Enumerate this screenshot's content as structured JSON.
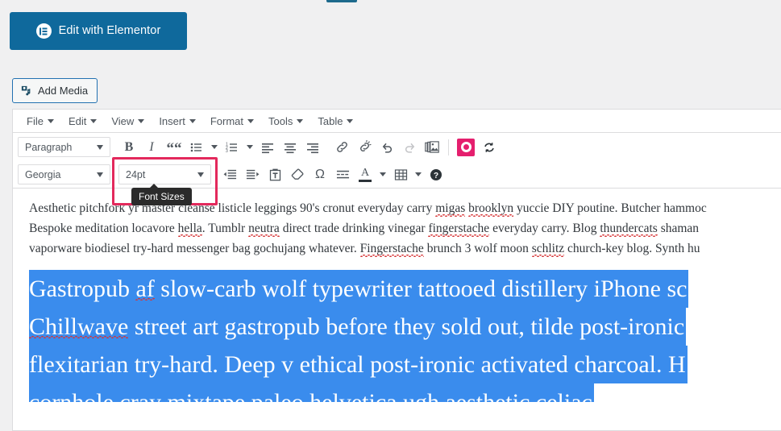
{
  "elementor_button": {
    "label": "Edit with Elementor",
    "icon": "elementor-logo-icon",
    "bg": "#0f699c"
  },
  "add_media_button": {
    "label": "Add Media",
    "icon": "media-icon"
  },
  "menubar": {
    "items": [
      {
        "label": "File"
      },
      {
        "label": "Edit"
      },
      {
        "label": "View"
      },
      {
        "label": "Insert"
      },
      {
        "label": "Format"
      },
      {
        "label": "Tools"
      },
      {
        "label": "Table"
      }
    ]
  },
  "toolbar_row1": {
    "format_select": {
      "value": "Paragraph"
    },
    "buttons": [
      {
        "name": "bold-button",
        "glyph": "B"
      },
      {
        "name": "italic-button",
        "glyph": "I"
      },
      {
        "name": "blockquote-button",
        "glyph": "“"
      },
      {
        "name": "bullet-list-button",
        "glyph": "bullist-icon"
      },
      {
        "name": "numbered-list-button",
        "glyph": "numlist-icon"
      },
      {
        "name": "align-left-button",
        "glyph": "alignleft-icon"
      },
      {
        "name": "align-center-button",
        "glyph": "aligncenter-icon"
      },
      {
        "name": "align-right-button",
        "glyph": "alignright-icon"
      },
      {
        "name": "insert-link-button",
        "glyph": "link-icon"
      },
      {
        "name": "remove-link-button",
        "glyph": "unlink-icon"
      },
      {
        "name": "undo-button",
        "glyph": "undo-icon"
      },
      {
        "name": "redo-button",
        "glyph": "redo-icon"
      },
      {
        "name": "insert-gallery-button",
        "glyph": "gallery-icon"
      },
      {
        "name": "yoast-button",
        "glyph": "yoast-icon"
      },
      {
        "name": "refresh-button",
        "glyph": "refresh-icon"
      }
    ]
  },
  "toolbar_row2": {
    "font_family_select": {
      "value": "Georgia"
    },
    "font_size_select": {
      "value": "24pt",
      "highlighted": true,
      "highlight_color": "#e3295c"
    },
    "tooltip": {
      "text": "Font Sizes"
    },
    "buttons": [
      {
        "name": "decrease-indent-button",
        "glyph": "outdent-icon"
      },
      {
        "name": "increase-indent-button",
        "glyph": "indent-icon"
      },
      {
        "name": "paste-as-text-button",
        "glyph": "pastetext-icon"
      },
      {
        "name": "clear-formatting-button",
        "glyph": "eraser-icon"
      },
      {
        "name": "special-character-button",
        "glyph": "omega-icon"
      },
      {
        "name": "read-more-button",
        "glyph": "readmore-icon"
      },
      {
        "name": "text-color-button",
        "glyph": "forecolor-icon"
      },
      {
        "name": "table-button",
        "glyph": "table-icon"
      },
      {
        "name": "keyboard-shortcuts-button",
        "glyph": "help-icon"
      }
    ]
  },
  "content": {
    "paragraph_lines": [
      "Aesthetic pitchfork yr master cleanse listicle leggings 90's cronut everyday carry migas brooklyn yuccie DIY poutine. Butcher hammoc",
      "Bespoke meditation locavore hella. Tumblr neutra direct trade drinking vinegar fingerstache everyday carry. Blog thundercats shaman",
      "vaporware biodiesel try-hard messenger bag gochujang whatever. Fingerstache brunch 3 wolf moon schlitz church-key blog. Synth hu"
    ],
    "selected_lines": [
      "Gastropub af slow-carb wolf typewriter tattooed distillery iPhone sc",
      "Chillwave street art gastropub before they sold out, tilde post-ironic",
      "flexitarian try-hard. Deep v ethical post-ironic activated charcoal. H",
      "cornhole cray mixtape paleo helvetica ugh aesthetic celiac"
    ],
    "selection_color": "#3a8ced",
    "selection_text_color": "#ffffff"
  }
}
